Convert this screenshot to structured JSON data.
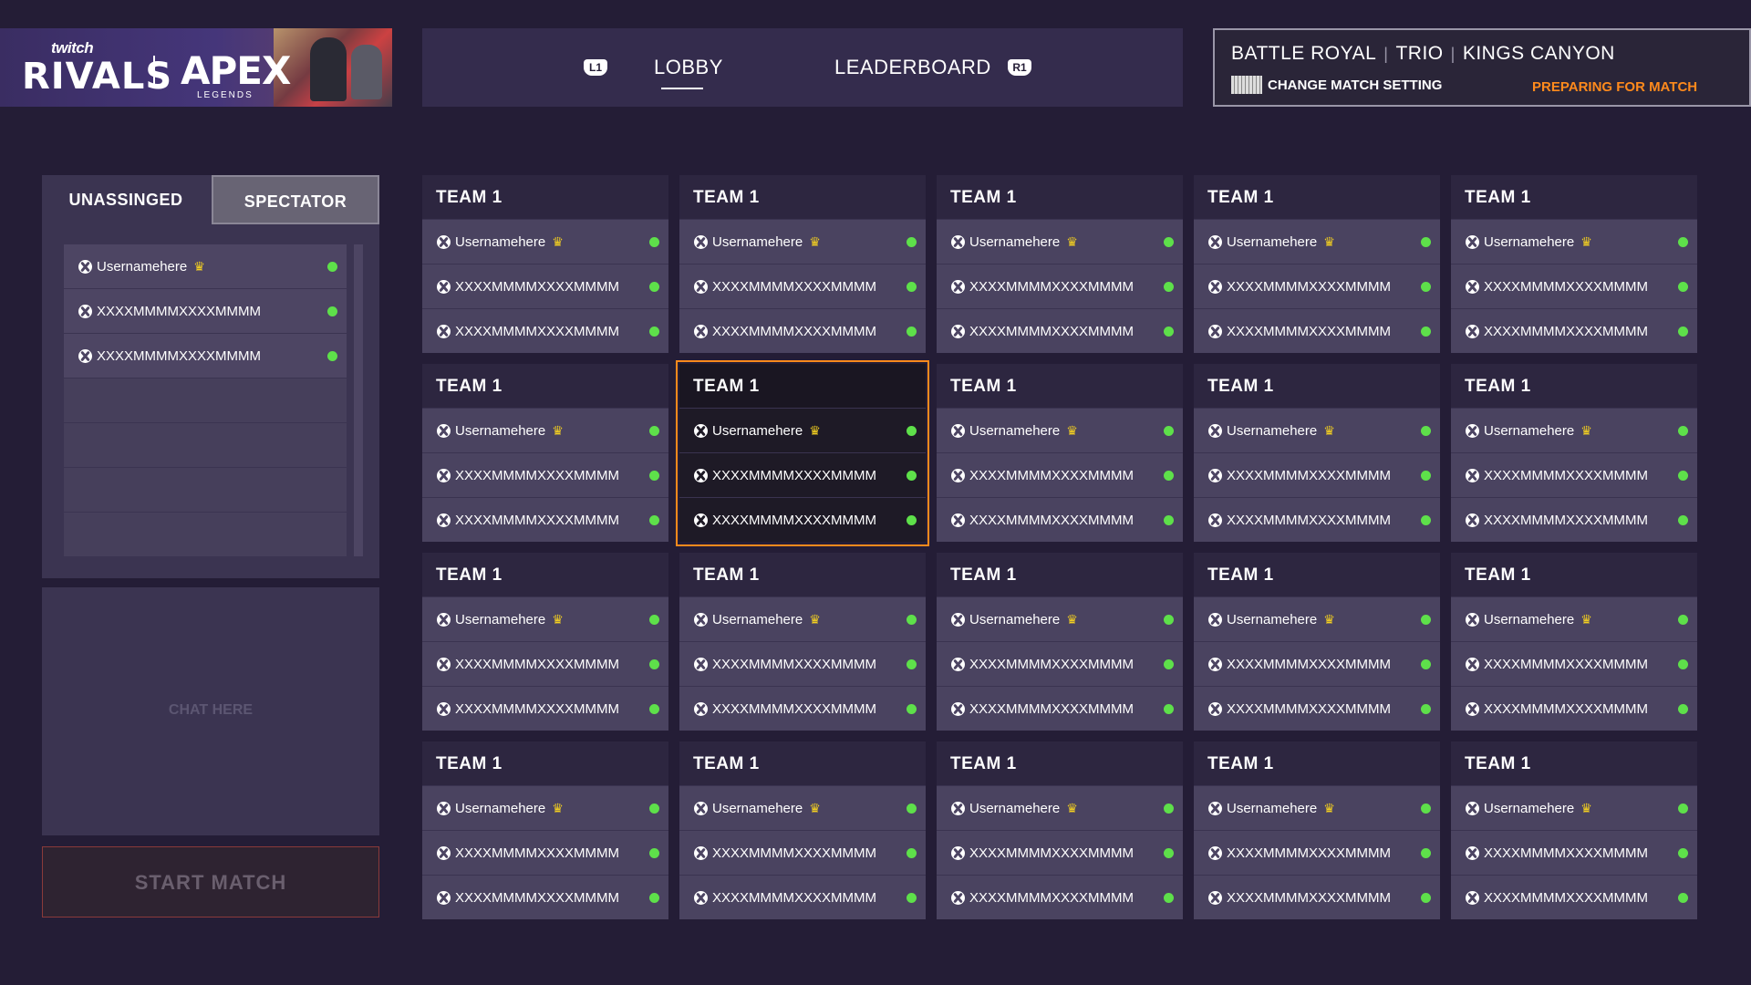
{
  "banner": {
    "twitch": "twitch",
    "rivals": "RIVALS",
    "apex": "APEX",
    "legends": "LEGENDS"
  },
  "nav": {
    "left_hint": "L1",
    "right_hint": "R1",
    "tabs": [
      {
        "label": "LOBBY",
        "active": true
      },
      {
        "label": "LEADERBOARD",
        "active": false
      }
    ]
  },
  "match": {
    "mode": "BATTLE ROYAL",
    "squad": "TRIO",
    "map": "KINGS CANYON",
    "change_label": "CHANGE MATCH SETTING",
    "status": "PREPARING FOR MATCH",
    "status_color": "#ff8a1c"
  },
  "left": {
    "tabs": [
      "UNASSINGED",
      "SPECTATOR"
    ],
    "players": [
      "Usernamehere",
      "XXXXMMMMXXXXMMMM",
      "XXXXMMMMXXXXMMMM"
    ],
    "empty_slots": 4,
    "chat_placeholder": "CHAT HERE",
    "start_label": "START MATCH"
  },
  "teams": {
    "rows": 4,
    "cols": 5,
    "selected_index": 6,
    "name": "TEAM 1",
    "players": [
      "Usernamehere",
      "XXXXMMMMXXXXMMMM",
      "XXXXMMMMXXXXMMMM"
    ],
    "leader_index": 0,
    "online_color": "#5ee04a"
  },
  "icons": {
    "platform": "xbox-icon",
    "leader": "crown-icon",
    "status": "online-dot-icon"
  }
}
